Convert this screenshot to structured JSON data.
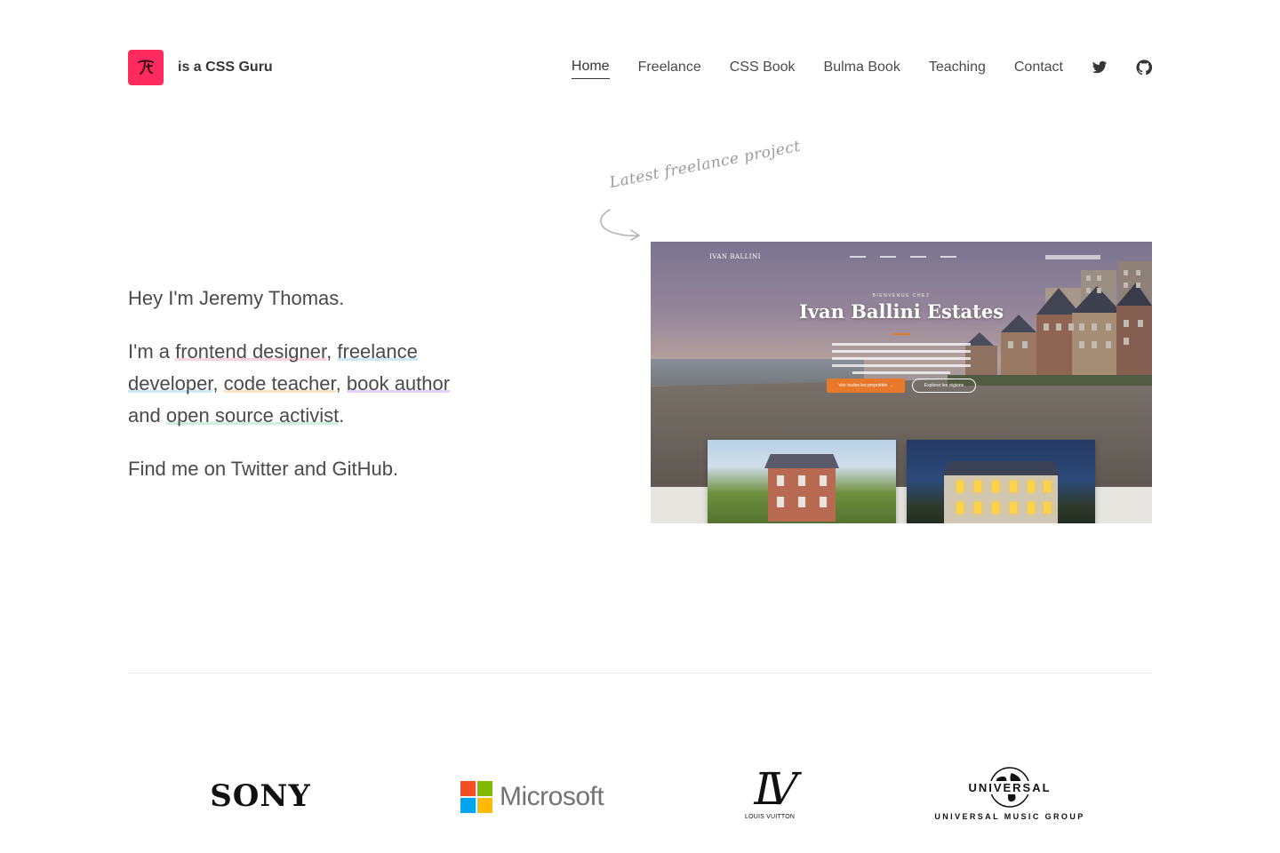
{
  "header": {
    "brand_text": "is a CSS Guru",
    "brand_color": "#ff2b5e",
    "nav": [
      {
        "label": "Home",
        "active": true
      },
      {
        "label": "Freelance"
      },
      {
        "label": "CSS Book"
      },
      {
        "label": "Bulma Book"
      },
      {
        "label": "Teaching"
      },
      {
        "label": "Contact"
      }
    ],
    "social_icons": [
      "twitter-icon",
      "github-icon"
    ]
  },
  "intro": {
    "greeting": "Hey I'm Jeremy Thomas.",
    "role_prefix": "I'm a ",
    "roles": [
      "frontend designer",
      "freelance developer",
      "code teacher",
      "book author",
      "open source activist"
    ],
    "sep1": ", ",
    "sep2": ", ",
    "sep3": ", ",
    "sep4_and": "and ",
    "role_suffix": ".",
    "find_me": "Find me on Twitter and GitHub."
  },
  "project": {
    "note": "Latest freelance project",
    "screenshot": {
      "logo": "IVAN BALLINI",
      "kicker": "BIENVENUE CHEZ",
      "title": "Ivan Ballini Estates",
      "button_primary": "Voir toutes les propriétés →",
      "button_secondary": "Explorer les régions"
    }
  },
  "clients": {
    "sony": "SONY",
    "microsoft": "Microsoft",
    "lv_mark": "LV",
    "lv_text": "LOUIS VUITTON",
    "umg_top": "UNIVERSAL",
    "umg_bottom": "UNIVERSAL MUSIC GROUP"
  }
}
